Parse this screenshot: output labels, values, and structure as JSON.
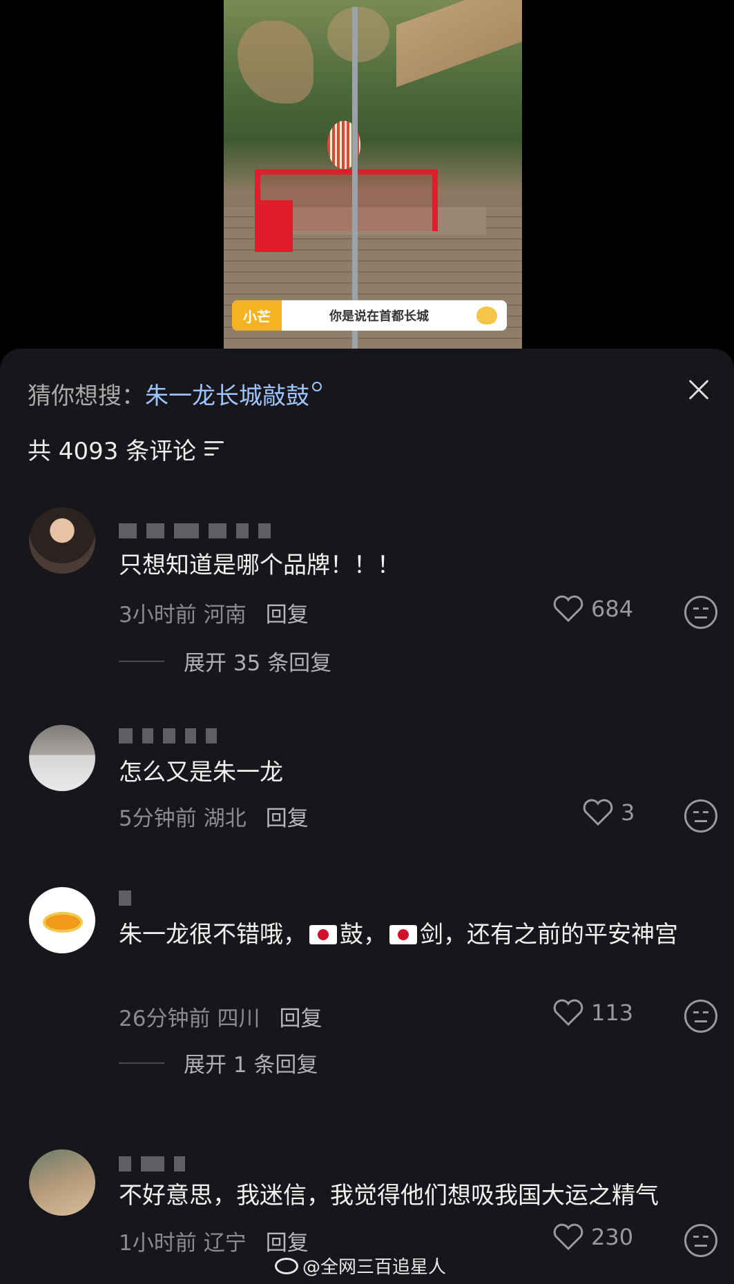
{
  "video": {
    "caption_tag": "小芒",
    "caption_text": "你是说在首都长城"
  },
  "sheet": {
    "search_prefix": "猜你想搜：",
    "search_term": "朱一龙长城敲鼓",
    "comment_count": "共 4093 条评论"
  },
  "comments": [
    {
      "text": "只想知道是哪个品牌！！！",
      "time": "3小时前",
      "location": "河南",
      "reply_label": "回复",
      "likes": "684",
      "expand_label": "展开 35 条回复"
    },
    {
      "text": "怎么又是朱一龙",
      "time": "5分钟前",
      "location": "湖北",
      "reply_label": "回复",
      "likes": "3"
    },
    {
      "text_part1": "朱一龙很不错哦，",
      "text_part2": "鼓，",
      "text_part3": "剑，还有之前的平安神宫",
      "time": "26分钟前",
      "location": "四川",
      "reply_label": "回复",
      "likes": "113",
      "expand_label": "展开 1 条回复"
    },
    {
      "text": "不好意思，我迷信，我觉得他们想吸我国大运之精气",
      "time": "1小时前",
      "location": "辽宁",
      "reply_label": "回复",
      "likes": "230"
    }
  ],
  "watermark": "@全网三百追星人",
  "colors": {
    "sheet_bg": "#16161b",
    "search_term": "#9ec4ff",
    "meta": "#8c8c90"
  }
}
